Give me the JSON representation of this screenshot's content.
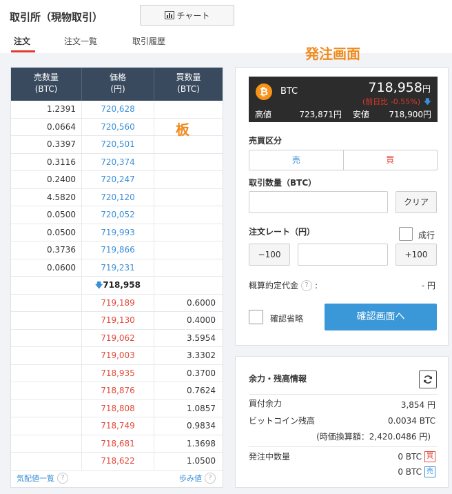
{
  "header": {
    "title": "取引所（現物取引）",
    "chart_button": "チャート",
    "tabs": [
      "注文",
      "注文一覧",
      "取引履歴"
    ]
  },
  "annotations": {
    "order_screen": "発注画面",
    "board": "板"
  },
  "order_book": {
    "headers": {
      "sell": "売数量\n(BTC)",
      "price": "価格\n(円)",
      "buy": "買数量\n(BTC)"
    },
    "asks": [
      {
        "qty": "1.2391",
        "price": "720,628"
      },
      {
        "qty": "0.0664",
        "price": "720,560"
      },
      {
        "qty": "0.3397",
        "price": "720,501"
      },
      {
        "qty": "0.3116",
        "price": "720,374"
      },
      {
        "qty": "0.2400",
        "price": "720,247"
      },
      {
        "qty": "4.5820",
        "price": "720,120"
      },
      {
        "qty": "0.0500",
        "price": "720,052"
      },
      {
        "qty": "0.0500",
        "price": "719,993"
      },
      {
        "qty": "0.3736",
        "price": "719,866"
      },
      {
        "qty": "0.0600",
        "price": "719,231"
      }
    ],
    "last_price": "718,958",
    "bids": [
      {
        "price": "719,189",
        "qty": "0.6000"
      },
      {
        "price": "719,130",
        "qty": "0.4000"
      },
      {
        "price": "719,062",
        "qty": "3.5954"
      },
      {
        "price": "719,003",
        "qty": "3.3302"
      },
      {
        "price": "718,935",
        "qty": "0.3700"
      },
      {
        "price": "718,876",
        "qty": "0.7624"
      },
      {
        "price": "718,808",
        "qty": "1.0857"
      },
      {
        "price": "718,749",
        "qty": "0.9834"
      },
      {
        "price": "718,681",
        "qty": "1.3698"
      },
      {
        "price": "718,622",
        "qty": "1.0500"
      }
    ],
    "footer_left": "気配値一覧",
    "footer_right": "歩み値"
  },
  "ticker": {
    "symbol": "BTC",
    "price": "718,958",
    "price_unit": "円",
    "change": "(前日比 -0.55%)",
    "high_label": "高値",
    "high": "723,871円",
    "low_label": "安値",
    "low": "718,900円"
  },
  "order_form": {
    "side_label": "売買区分",
    "sell": "売",
    "buy": "買",
    "qty_label": "取引数量（BTC）",
    "clear": "クリア",
    "rate_label": "注文レート（円）",
    "market_order": "成行",
    "minus": "−100",
    "plus": "+100",
    "estimate_label": "概算約定代金",
    "estimate_value": "- 円",
    "skip_confirm": "確認省略",
    "confirm_button": "確認画面へ"
  },
  "balance": {
    "title": "余力・残高情報",
    "buy_power_label": "買付余力",
    "buy_power": "3,854 円",
    "btc_balance_label": "ビットコイン残高",
    "btc_balance": "0.0034 BTC",
    "btc_value": "(時価換算額：2,420.0486 円)",
    "pending_label": "発注中数量",
    "pending_buy": "0 BTC",
    "pending_sell": "0 BTC",
    "buy_tag": "買",
    "sell_tag": "売"
  }
}
